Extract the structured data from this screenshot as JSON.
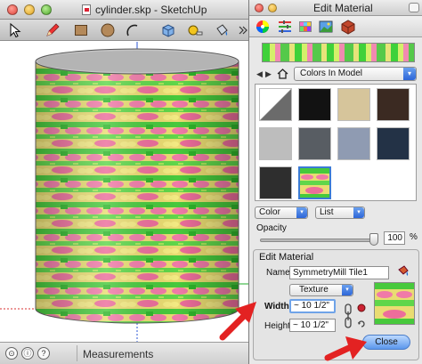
{
  "sketchup": {
    "title": "cylinder.skp - SketchUp",
    "status": {
      "measurements_label": "Measurements"
    }
  },
  "edit_material": {
    "title": "Edit Material",
    "browser": {
      "collection": "Colors In Model",
      "swatches": [
        "diagonal-white-gray",
        "#121212",
        "#d6c59b",
        "#3b2a22",
        "#bdbdbd",
        "#585d63",
        "#8f9bb2",
        "#233246",
        "#2e2e2e",
        "texture-symmetrymill"
      ]
    },
    "display_select": "Color",
    "view_select": "List",
    "opacity": {
      "label": "Opacity",
      "value": "100",
      "unit": "%",
      "level": 1.0
    },
    "section_title": "Edit Material",
    "name_label": "Name",
    "name_value": "SymmetryMill Tile1",
    "texture_label": "Texture",
    "width_label": "Width",
    "width_value": "~ 10 1/2\"",
    "height_label": "Height",
    "height_value": "~ 10 1/2\"",
    "close_label": "Close"
  },
  "colors": {
    "accent_blue": "#5b97ec",
    "annotation_red": "#e32222",
    "texture_green": "#3fd13a"
  }
}
